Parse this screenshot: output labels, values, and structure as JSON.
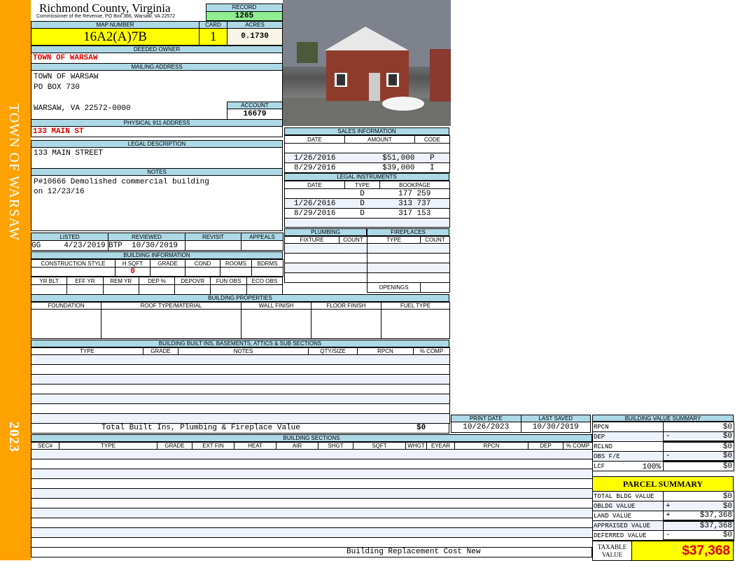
{
  "sidebar": {
    "owner": "TOWN OF WARSAW",
    "year": "2023"
  },
  "header": {
    "county": "Richmond County, Virginia",
    "office": "Commissioner of the Revenue, PO Box 366, Warsaw, VA 22572"
  },
  "record": {
    "label": "RECORD",
    "value": "1265"
  },
  "map": {
    "label": "MAP NUMBER",
    "value": "16A2(A)7B",
    "card_label": "CARD",
    "card": "1",
    "acres_label": "ACRES",
    "acres": "0.1730"
  },
  "owner": {
    "label": "DEEDED OWNER",
    "value": "TOWN OF WARSAW"
  },
  "mailing": {
    "label": "MAILING ADDRESS",
    "line1": "TOWN OF WARSAW",
    "line2": "PO BOX 730",
    "line3": "WARSAW, VA 22572-0000",
    "account_label": "ACCOUNT",
    "account": "16679"
  },
  "physical": {
    "label": "PHYSICAL 911 ADDRESS",
    "value": "133 MAIN ST"
  },
  "legal": {
    "label": "LEGAL DESCRIPTION",
    "value": "133 MAIN STREET"
  },
  "notes": {
    "label": "NOTES",
    "line1": "P#10666 Demolished commercial building",
    "line2": "on 12/23/16"
  },
  "listing": {
    "headers": [
      "LISTED",
      "REVIEWED",
      "REVISIT",
      "APPEALS"
    ],
    "listed": "GG     4/23/2019",
    "reviewed": "BTP  10/30/2019"
  },
  "building_info": {
    "label": "BUILDING INFORMATION",
    "headers1": [
      "CONSTRUCTION STYLE",
      "H SQFT",
      "GRADE",
      "COND",
      "ROOMS",
      "BDRMS"
    ],
    "hsqft": "0",
    "headers2": [
      "YR BLT",
      "EFF YR",
      "REM YR",
      "DEP %",
      "DEPOVR",
      "FUN OBS",
      "ECO OBS"
    ]
  },
  "sales": {
    "label": "SALES INFORMATION",
    "headers": [
      "DATE",
      "AMOUNT",
      "CODE"
    ],
    "rows": [
      {
        "date": "1/26/2016",
        "amount": "$51,000",
        "code": "P"
      },
      {
        "date": "8/29/2016",
        "amount": "$39,000",
        "code": "I"
      }
    ]
  },
  "instruments": {
    "label": "LEGAL INSTRUMENTS",
    "headers": [
      "DATE",
      "TYPE",
      "BOOKPAGE"
    ],
    "rows": [
      {
        "date": "",
        "type": "D",
        "book": "177 259"
      },
      {
        "date": "1/26/2016",
        "type": "D",
        "book": "313 737"
      },
      {
        "date": "8/29/2016",
        "type": "D",
        "book": "317 153"
      }
    ]
  },
  "plumbing": {
    "label": "PLUMBING",
    "headers": [
      "FIXTURE",
      "COUNT"
    ]
  },
  "fireplaces": {
    "label": "FIREPLACES",
    "headers": [
      "TYPE",
      "COUNT"
    ],
    "openings": "OPENINGS"
  },
  "properties": {
    "label": "BUILDING PROPERTIES",
    "headers": [
      "FOUNDATION",
      "ROOF TYPE/MATERIAL",
      "WALL FINISH",
      "FLOOR FINISH",
      "FUEL TYPE"
    ]
  },
  "builtins": {
    "label": "BUILDING BUILT INS, BASEMENTS, ATTICS & SUB SECTIONS",
    "headers": [
      "TYPE",
      "GRADE",
      "NOTES",
      "QTY/SIZE",
      "RPCN",
      "% COMP"
    ],
    "total_label": "Total Built Ins, Plumbing & Fireplace Value",
    "total": "$0"
  },
  "dates": {
    "print_label": "PRINT DATE",
    "print": "10/26/2023",
    "saved_label": "LAST SAVED",
    "saved": "10/30/2019"
  },
  "sections": {
    "label": "BUILDING SECTIONS",
    "headers": [
      "SEC#",
      "TYPE",
      "GRADE",
      "EXT FIN",
      "HEAT",
      "AIR",
      "SHGT",
      "SQFT",
      "WHGT",
      "EYEAR",
      "RPCN",
      "DEP",
      "% COMP"
    ],
    "footer": "Building Replacement Cost New"
  },
  "bvs": {
    "label": "BUILDING VALUE SUMMARY",
    "rows": [
      {
        "k": "RPCN",
        "op": "",
        "v": "$0"
      },
      {
        "k": "DEP",
        "op": "-",
        "v": "$0"
      },
      {
        "k": "RCLND",
        "op": "",
        "v": "$0"
      },
      {
        "k": "OBS F/E",
        "op": "-",
        "v": "$0"
      },
      {
        "k": "LCF",
        "pct": "100%",
        "op": "",
        "v": "$0"
      }
    ]
  },
  "parcel": {
    "label": "PARCEL SUMMARY",
    "rows": [
      {
        "k": "TOTAL BLDG VALUE",
        "op": "",
        "v": "$0"
      },
      {
        "k": "OBLDG VALUE",
        "op": "+",
        "v": "$0"
      },
      {
        "k": "LAND VALUE",
        "op": "+",
        "v": "$37,368"
      },
      {
        "k": "APPRAISED VALUE",
        "op": "",
        "v": "$37,368"
      },
      {
        "k": "DEFERRED VALUE",
        "op": "-",
        "v": "$0"
      }
    ],
    "taxable_label": "TAXABLE VALUE",
    "taxable": "$37,368"
  },
  "colors": {
    "sidebar": "#FFA200",
    "header": "#ADD8E6",
    "yellow": "#FFFF00",
    "green": "#90EE90",
    "red": "#E00000"
  }
}
